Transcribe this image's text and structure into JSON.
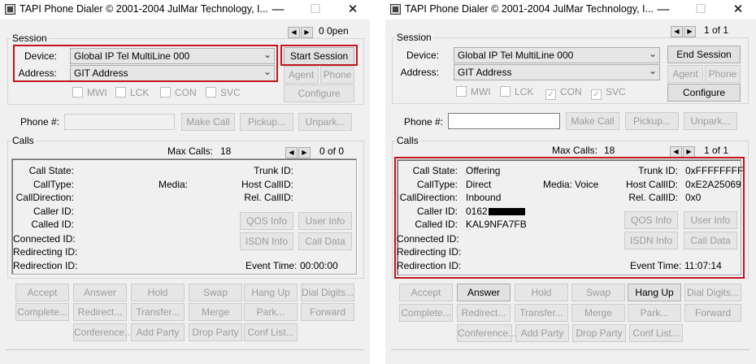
{
  "left": {
    "title": "TAPI Phone Dialer © 2001-2004 JulMar Technology, I...",
    "session": {
      "group_label": "Session",
      "line_counter": "0 0pen",
      "device_label": "Device:",
      "device_value": "Global IP Tel MultiLine 000",
      "address_label": "Address:",
      "address_value": "GIT Address",
      "session_button": "Start Session",
      "agent_button": "Agent",
      "phone_button": "Phone",
      "configure_button": "Configure",
      "flags": [
        {
          "label": "MWI",
          "checked": false
        },
        {
          "label": "LCK",
          "checked": false
        },
        {
          "label": "CON",
          "checked": false
        },
        {
          "label": "SVC",
          "checked": false
        }
      ]
    },
    "phone_label": "Phone #:",
    "make_call": "Make Call",
    "pickup": "Pickup...",
    "unpark": "Unpark...",
    "calls": {
      "group_label": "Calls",
      "max_calls_label": "Max Calls:",
      "max_calls_value": "18",
      "counter": "0 of 0",
      "call_state_label": "Call State:",
      "call_state_value": "",
      "call_type_label": "CallType:",
      "call_type_value": "",
      "media_label": "Media:",
      "media_value": "",
      "call_direction_label": "CallDirection:",
      "call_direction_value": "",
      "caller_id_label": "Caller ID:",
      "caller_id_value": "",
      "called_id_label": "Called ID:",
      "called_id_value": "",
      "connected_id_label": "Connected ID:",
      "redirecting_id_label": "Redirecting ID:",
      "redirection_id_label": "Redirection ID:",
      "trunk_id_label": "Trunk ID:",
      "trunk_id_value": "",
      "host_callid_label": "Host CallID:",
      "host_callid_value": "",
      "rel_callid_label": "Rel. CallID:",
      "rel_callid_value": "",
      "event_time_label": "Event Time:",
      "event_time_value": "00:00:00",
      "qos_info": "QOS Info",
      "user_info": "User Info",
      "isdn_info": "ISDN Info",
      "call_data": "Call Data"
    },
    "actions": {
      "accept": "Accept",
      "answer": "Answer",
      "hold": "Hold",
      "swap": "Swap",
      "hang_up": "Hang Up",
      "dial_digits": "Dial Digits...",
      "complete": "Complete...",
      "redirect": "Redirect...",
      "transfer": "Transfer...",
      "merge": "Merge",
      "park": "Park...",
      "forward": "Forward",
      "conference": "Conference...",
      "add_party": "Add Party",
      "drop_party": "Drop Party",
      "conf_list": "Conf List..."
    }
  },
  "right": {
    "title": "TAPI Phone Dialer © 2001-2004 JulMar Technology, I...",
    "session": {
      "group_label": "Session",
      "line_counter": "1 of 1",
      "device_label": "Device:",
      "device_value": "Global IP Tel MultiLine 000",
      "address_label": "Address:",
      "address_value": "GIT Address",
      "session_button": "End Session",
      "agent_button": "Agent",
      "phone_button": "Phone",
      "configure_button": "Configure",
      "flags": [
        {
          "label": "MWI",
          "checked": false
        },
        {
          "label": "LCK",
          "checked": false
        },
        {
          "label": "CON",
          "checked": true
        },
        {
          "label": "SVC",
          "checked": true
        }
      ]
    },
    "phone_label": "Phone #:",
    "make_call": "Make Call",
    "pickup": "Pickup...",
    "unpark": "Unpark...",
    "calls": {
      "group_label": "Calls",
      "max_calls_label": "Max Calls:",
      "max_calls_value": "18",
      "counter": "1 of 1",
      "call_state_label": "Call State:",
      "call_state_value": "Offering",
      "call_type_label": "CallType:",
      "call_type_value": "Direct",
      "media_label": "Media:",
      "media_value": "Voice",
      "call_direction_label": "CallDirection:",
      "call_direction_value": "Inbound",
      "caller_id_label": "Caller ID:",
      "caller_id_value": "0162",
      "called_id_label": "Called ID:",
      "called_id_value": "KAL9NFA7FB",
      "connected_id_label": "Connected ID:",
      "redirecting_id_label": "Redirecting ID:",
      "redirection_id_label": "Redirection ID:",
      "trunk_id_label": "Trunk ID:",
      "trunk_id_value": "0xFFFFFFFF",
      "host_callid_label": "Host CallID:",
      "host_callid_value": "0xE2A25069",
      "rel_callid_label": "Rel. CallID:",
      "rel_callid_value": "0x0",
      "event_time_label": "Event Time:",
      "event_time_value": "11:07:14",
      "qos_info": "QOS Info",
      "user_info": "User Info",
      "isdn_info": "ISDN Info",
      "call_data": "Call Data"
    },
    "actions": {
      "accept": "Accept",
      "answer": "Answer",
      "hold": "Hold",
      "swap": "Swap",
      "hang_up": "Hang Up",
      "dial_digits": "Dial Digits...",
      "complete": "Complete...",
      "redirect": "Redirect...",
      "transfer": "Transfer...",
      "merge": "Merge",
      "park": "Park...",
      "forward": "Forward",
      "conference": "Conference...",
      "add_party": "Add Party",
      "drop_party": "Drop Party",
      "conf_list": "Conf List..."
    }
  },
  "colors": {
    "highlight": "#c0161c",
    "window_bg": "#f0f0f0"
  }
}
